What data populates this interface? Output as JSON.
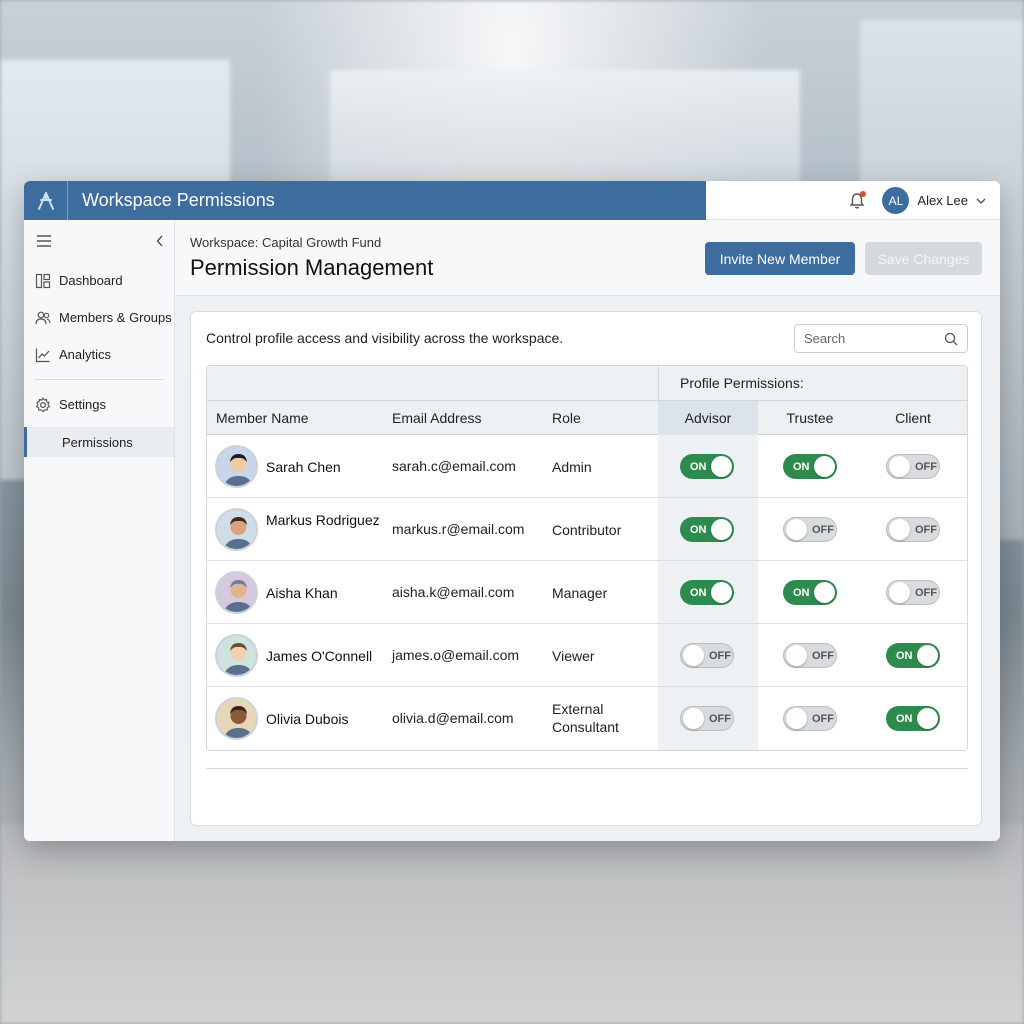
{
  "app": {
    "title": "Workspace Permissions",
    "brand_color": "#3d6c9e",
    "user": {
      "initials": "AL",
      "name": "Alex Lee"
    }
  },
  "sidebar": {
    "items": [
      {
        "label": "Dashboard",
        "icon": "dashboard-icon"
      },
      {
        "label": "Members & Groups",
        "icon": "members-icon"
      },
      {
        "label": "Analytics",
        "icon": "analytics-icon"
      },
      {
        "label": "Settings",
        "icon": "gear-icon"
      }
    ],
    "sub_item": {
      "label": "Permissions",
      "active": true
    }
  },
  "header": {
    "workspace": "Workspace: Capital Growth Fund",
    "title": "Permission Management",
    "invite_label": "Invite New Member",
    "save_label": "Save Changes"
  },
  "card": {
    "description": "Control profile access and visibility across the workspace.",
    "search_placeholder": "Search"
  },
  "table": {
    "group_header": "Profile Permissions:",
    "columns": {
      "name": "Member Name",
      "email": "Email Address",
      "role": "Role",
      "advisor": "Advisor",
      "trustee": "Trustee",
      "client": "Client"
    },
    "on_label": "ON",
    "off_label": "OFF",
    "rows": [
      {
        "name": "Sarah Chen",
        "email": "sarah.c@email.com",
        "role": "Admin",
        "advisor": true,
        "trustee": true,
        "client": false
      },
      {
        "name": "Markus Rodriguez",
        "email": "markus.r@email.com",
        "role": "Contributor",
        "advisor": true,
        "trustee": false,
        "client": false
      },
      {
        "name": "Aisha Khan",
        "email": "aisha.k@email.com",
        "role": "Manager",
        "advisor": true,
        "trustee": true,
        "client": false
      },
      {
        "name": "James O'Connell",
        "email": "james.o@email.com",
        "role": "Viewer",
        "advisor": false,
        "trustee": false,
        "client": true
      },
      {
        "name": "Olivia Dubois",
        "email": "olivia.d@email.com",
        "role": "External Consultant",
        "advisor": false,
        "trustee": false,
        "client": true
      }
    ]
  }
}
